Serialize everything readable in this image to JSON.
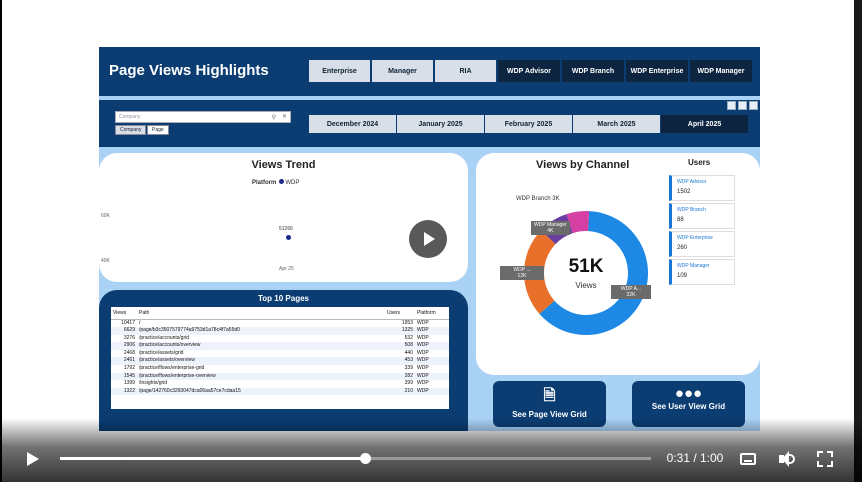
{
  "header": {
    "title": "Page Views Highlights",
    "tabs": [
      {
        "label": "Enterprise",
        "style": "light"
      },
      {
        "label": "Manager",
        "style": "light"
      },
      {
        "label": "RIA",
        "style": "light"
      },
      {
        "label": "WDP Advisor",
        "style": "dark"
      },
      {
        "label": "WDP Branch",
        "style": "dark"
      },
      {
        "label": "WDP Enterprise",
        "style": "dark"
      },
      {
        "label": "WDP Manager",
        "style": "dark"
      }
    ]
  },
  "filters": {
    "search_placeholder": "Company",
    "chips": [
      "Company",
      "Page"
    ],
    "months": [
      "December 2024",
      "January 2025",
      "February 2025",
      "March 2025",
      "April 2025"
    ],
    "selected_month": "April 2025"
  },
  "views_trend": {
    "title": "Views Trend",
    "legend_label": "Platform",
    "legend_series": "WDP",
    "y_ticks": [
      "60K",
      "40K"
    ],
    "point_label": "51266",
    "x_tick": "Apr 25"
  },
  "views_by_channel": {
    "title": "Views by Channel",
    "center_value": "51K",
    "center_label": "Views",
    "labels": {
      "branch": "WDP Branch 3K",
      "manager": [
        "WDP Manager",
        "4K"
      ],
      "left": [
        "WDP ...",
        "12K"
      ],
      "right": [
        "WDP A...",
        "32K"
      ]
    }
  },
  "users": {
    "title": "Users",
    "items": [
      {
        "label": "WDP Advisor",
        "value": "1502"
      },
      {
        "label": "WDP Branch",
        "value": "88"
      },
      {
        "label": "WDP Enterprise",
        "value": "260"
      },
      {
        "label": "WDP Manager",
        "value": "109"
      }
    ]
  },
  "top10": {
    "title": "Top 10 Pages",
    "columns": [
      "Views",
      "Path",
      "Users",
      "Platform"
    ],
    "rows": [
      [
        "10417",
        "/",
        "1953",
        "WDP"
      ],
      [
        "6629",
        "/page/b3c3507579774a9753d1a78c4f7a55d0",
        "1325",
        "WDP"
      ],
      [
        "3276",
        "/practice/accounts/grid",
        "532",
        "WDP"
      ],
      [
        "2906",
        "/practice/accounts/overview",
        "508",
        "WDP"
      ],
      [
        "2468",
        "/practice/assets/grid",
        "440",
        "WDP"
      ],
      [
        "2461",
        "/practice/assets/overview",
        "453",
        "WDP"
      ],
      [
        "1792",
        "/practice/flows/enterprise-grid",
        "339",
        "WDP"
      ],
      [
        "1545",
        "/practice/flows/enterprise-overview",
        "282",
        "WDP"
      ],
      [
        "1399",
        "/insights/grid",
        "399",
        "WDP"
      ],
      [
        "1322",
        "/page/142760c3293047dca06aa57ce7cdaa15",
        "210",
        "WDP"
      ]
    ]
  },
  "nav_buttons": {
    "page_view": "See Page View Grid",
    "user_view": "See User View Grid"
  },
  "chart_data": {
    "type": "pie",
    "title": "Views by Channel",
    "categories": [
      "WDP Advisor",
      "WDP ...",
      "WDP Manager",
      "WDP Branch"
    ],
    "values": [
      32,
      12,
      4,
      3
    ],
    "colors": [
      "#1e88e5",
      "#e8702a",
      "#6a3ea1",
      "#d63fa4"
    ]
  },
  "player": {
    "time": "0:31 / 1:00",
    "progress": 0.5167
  },
  "colors": {
    "navy": "#0b3d73",
    "panel_bg": "#a9d2f5"
  }
}
